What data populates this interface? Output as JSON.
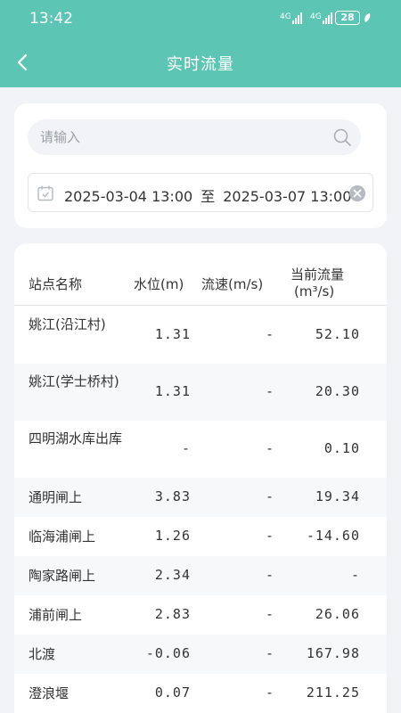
{
  "status_bar": {
    "time": "13:42",
    "signal1": "4G",
    "signal2": "4G",
    "battery": "28"
  },
  "header": {
    "title": "实时流量"
  },
  "search": {
    "placeholder": "请输入"
  },
  "date_range": {
    "start": "2025-03-04 13:00",
    "separator": "至",
    "end": "2025-03-07 13:00"
  },
  "table": {
    "headers": {
      "station": "站点名称",
      "level": "水位(m)",
      "speed": "流速(m/s)",
      "flow_line1": "当前流量",
      "flow_line2": "(m³/s)"
    },
    "rows": [
      {
        "station": "姚江(沿江村)",
        "level": "1.31",
        "speed": "-",
        "flow": "52.10"
      },
      {
        "station": "姚江(学士桥村)",
        "level": "1.31",
        "speed": "-",
        "flow": "20.30"
      },
      {
        "station": "四明湖水库出库",
        "level": "-",
        "speed": "-",
        "flow": "0.10"
      },
      {
        "station": "通明闸上",
        "level": "3.83",
        "speed": "-",
        "flow": "19.34"
      },
      {
        "station": "临海浦闸上",
        "level": "1.26",
        "speed": "-",
        "flow": "-14.60"
      },
      {
        "station": "陶家路闸上",
        "level": "2.34",
        "speed": "-",
        "flow": "-"
      },
      {
        "station": "浦前闸上",
        "level": "2.83",
        "speed": "-",
        "flow": "26.06"
      },
      {
        "station": "北渡",
        "level": "-0.06",
        "speed": "-",
        "flow": "167.98"
      },
      {
        "station": "澄浪堰",
        "level": "0.07",
        "speed": "-",
        "flow": "211.25"
      }
    ]
  },
  "colors": {
    "header": "#5dc5b4",
    "background": "#f1f3f6",
    "card": "#ffffff"
  },
  "icons": [
    "back-arrow-icon",
    "search-icon",
    "calendar-icon",
    "clear-icon",
    "battery-icon",
    "signal-icon",
    "leaf-icon"
  ]
}
